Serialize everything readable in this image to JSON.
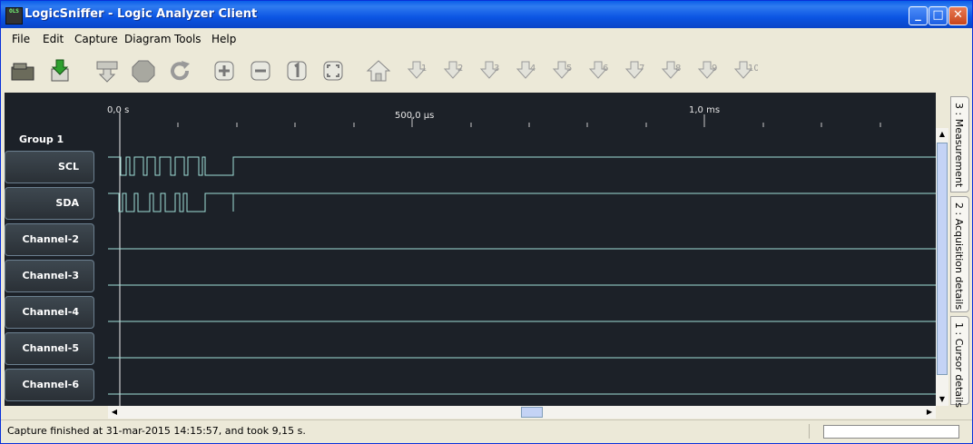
{
  "window": {
    "title": "LogicSniffer - Logic Analyzer Client",
    "icon_text": "OLS"
  },
  "menu": [
    "File",
    "Edit",
    "Capture",
    "Diagram",
    "Tools",
    "Help"
  ],
  "toolbar": {
    "buttons": [
      "open-icon",
      "save-icon",
      "capture-icon",
      "stop-icon",
      "repeat-icon",
      "zoom-in-icon",
      "zoom-out-icon",
      "zoom-original-icon",
      "zoom-fit-icon",
      "home-icon"
    ],
    "markers": [
      "1",
      "2",
      "3",
      "4",
      "5",
      "6",
      "7",
      "8",
      "9",
      "10"
    ]
  },
  "timeline": {
    "labels": [
      "0,0 s",
      "500,0 µs",
      "1,0 ms"
    ]
  },
  "group": {
    "name": "Group 1"
  },
  "channels": [
    "SCL",
    "SDA",
    "Channel-2",
    "Channel-3",
    "Channel-4",
    "Channel-5",
    "Channel-6"
  ],
  "side_tabs": [
    "3 : Measurement",
    "2 : Acquisition details",
    "1 : Cursor details"
  ],
  "status": {
    "message": "Capture finished at 31-mar-2015 14:15:57, and took 9,15 s."
  },
  "colors": {
    "signal": "#9fe0d8",
    "background": "#1c2128",
    "title_bar": "#0a5ee8"
  }
}
